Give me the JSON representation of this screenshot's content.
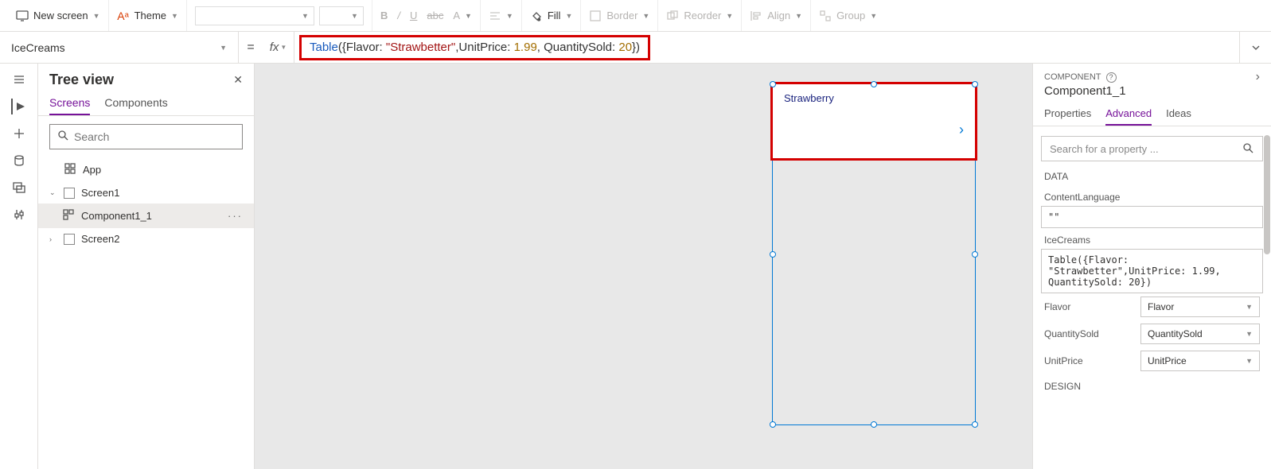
{
  "toolbar": {
    "new_screen": "New screen",
    "theme": "Theme",
    "fill": "Fill",
    "border": "Border",
    "reorder": "Reorder",
    "align": "Align",
    "group": "Group"
  },
  "formula": {
    "property": "IceCreams",
    "fx_label": "fx",
    "tokens": {
      "fn": "Table",
      "p1": "({Flavor: ",
      "str": "\"Strawbetter\"",
      "p2": ",UnitPrice: ",
      "n1": "1.99",
      "p3": ", QuantitySold: ",
      "n2": "20",
      "p4": "})"
    }
  },
  "tree": {
    "title": "Tree view",
    "tab_screens": "Screens",
    "tab_components": "Components",
    "search_placeholder": "Search",
    "app": "App",
    "screen1": "Screen1",
    "component": "Component1_1",
    "screen2": "Screen2"
  },
  "canvas": {
    "list_item_text": "Strawberry"
  },
  "right": {
    "header": "COMPONENT",
    "title": "Component1_1",
    "tab_properties": "Properties",
    "tab_advanced": "Advanced",
    "tab_ideas": "Ideas",
    "search_placeholder": "Search for a property ...",
    "section_data": "DATA",
    "content_language_label": "ContentLanguage",
    "content_language_value": "\"\"",
    "icecreams_label": "IceCreams",
    "icecreams_value": "Table({Flavor: \"Strawbetter\",UnitPrice: 1.99, QuantitySold: 20})",
    "flavor_label": "Flavor",
    "flavor_value": "Flavor",
    "qty_label": "QuantitySold",
    "qty_value": "QuantitySold",
    "price_label": "UnitPrice",
    "price_value": "UnitPrice",
    "section_design": "DESIGN"
  }
}
